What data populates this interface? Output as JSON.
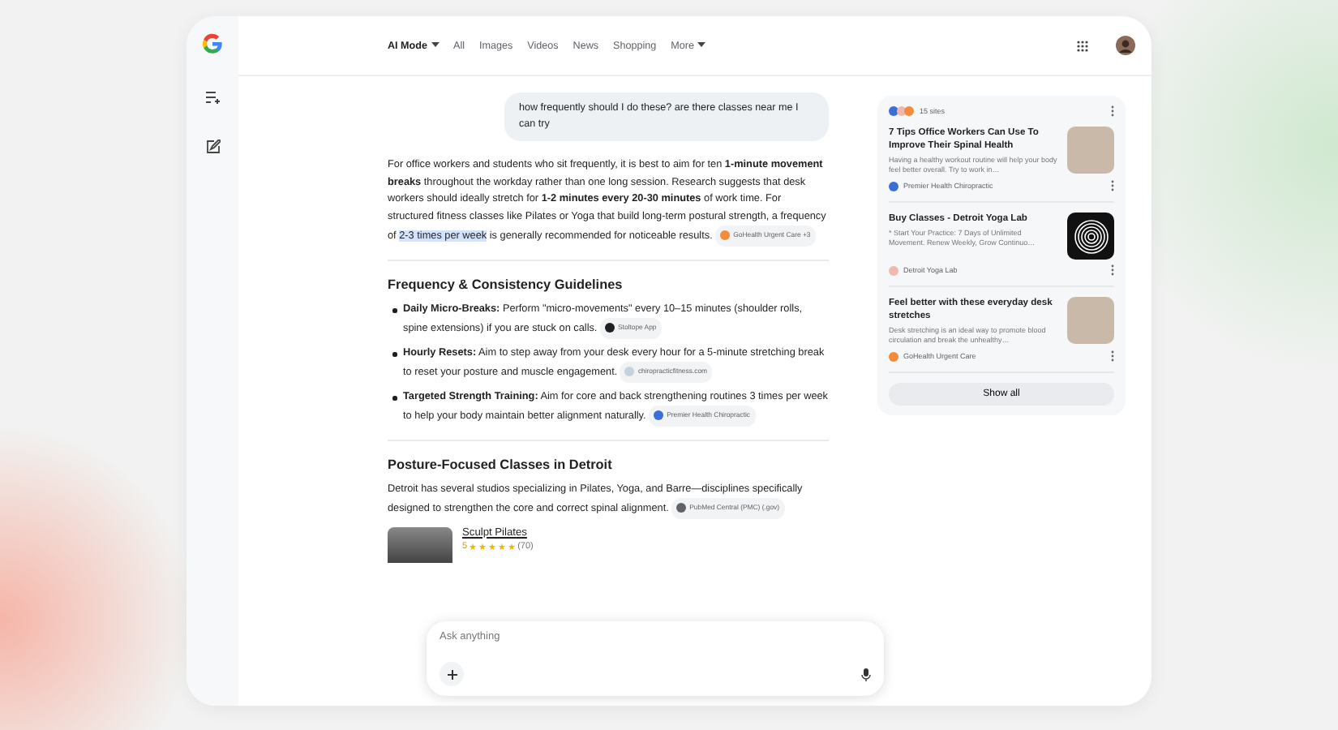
{
  "nav": {
    "tabs": [
      {
        "label": "AI Mode",
        "selected": true,
        "dropdown": true
      },
      {
        "label": "All",
        "selected": false,
        "dropdown": false
      },
      {
        "label": "Images",
        "selected": false,
        "dropdown": false
      },
      {
        "label": "Videos",
        "selected": false,
        "dropdown": false
      },
      {
        "label": "News",
        "selected": false,
        "dropdown": false
      },
      {
        "label": "Shopping",
        "selected": false,
        "dropdown": false
      },
      {
        "label": "More",
        "selected": false,
        "dropdown": true
      }
    ]
  },
  "query": "how frequently should I do these? are there classes near me I can try",
  "answer": {
    "segments": [
      {
        "kind": "plain",
        "text": "For office workers and students who sit frequently, it is best to aim for ten "
      },
      {
        "kind": "bold",
        "text": "1-minute movement breaks"
      },
      {
        "kind": "plain",
        "text": " throughout the workday rather than one long session. Research suggests that desk workers should ideally stretch for "
      },
      {
        "kind": "bold",
        "text": "1-2 minutes every 20-30 minutes"
      },
      {
        "kind": "plain",
        "text": " of work time. For structured fitness classes like Pilates or Yoga that build long-term postural strength, a frequency of "
      },
      {
        "kind": "highlight",
        "text": "2-3 times per week"
      },
      {
        "kind": "plain",
        "text": " is generally recommended for noticeable results. "
      }
    ],
    "citation": {
      "label": "GoHealth Urgent Care +3",
      "color": "#f28b3c"
    }
  },
  "sections": [
    {
      "heading": "Frequency & Consistency Guidelines",
      "kind": "bullets",
      "items": [
        {
          "lead": "Daily Micro-Breaks:",
          "text": " Perform \"micro-movements\" every 10–15 minutes (shoulder rolls, spine extensions) if you are stuck on calls. ",
          "citation": {
            "label": "Stoltope App",
            "color": "#202124"
          }
        },
        {
          "lead": "Hourly Resets:",
          "text": " Aim to step away from your desk every hour for a 5-minute stretching break to reset your posture and muscle engagement. ",
          "citation": {
            "label": "chiropracticfitness.com",
            "color": "#c7d2e0"
          }
        },
        {
          "lead": "Targeted Strength Training:",
          "text": " Aim for core and back strengthening routines 3 times per week to help your body maintain better alignment naturally. ",
          "citation": {
            "label": "Premier Health Chiropractic",
            "color": "#3b6fd8"
          }
        }
      ]
    },
    {
      "heading": "Posture-Focused Classes in Detroit",
      "kind": "places",
      "text": "Detroit has several studios specializing in Pilates, Yoga, and Barre—disciplines specifically designed to strengthen the core and correct spinal alignment. ",
      "citation": {
        "label": "PubMed Central (PMC) (.gov)",
        "color": "#5f6368"
      },
      "places": [
        {
          "name": "Sculpt Pilates",
          "rating": "5",
          "stars": 5,
          "count": "(70)"
        }
      ]
    }
  ],
  "input": {
    "placeholder": "Ask anything"
  },
  "sources": {
    "count": "15 sites",
    "button": "Show all",
    "items": [
      {
        "title": "7 Tips Office Workers Can Use To Improve Their Spinal Health",
        "snippet": "Having a healthy workout routine will help your body feel better overall. Try to work in…",
        "source": "Premier Health Chiropractic",
        "color": "#3b6fd8",
        "kind": "photo"
      },
      {
        "title": "Buy Classes - Detroit Yoga Lab",
        "snippet": "* Start Your Practice: 7 Days of Unlimited Movement. Renew Weekly, Grow Continuo…",
        "source": "Detroit Yoga Lab",
        "color": "#f2b8b0",
        "kind": "logo"
      },
      {
        "title": "Feel better with these everyday desk stretches",
        "snippet": "Desk stretching is an ideal way to promote blood circulation and break the unhealthy…",
        "source": "GoHealth Urgent Care",
        "color": "#f28b3c",
        "kind": "photo"
      }
    ]
  }
}
